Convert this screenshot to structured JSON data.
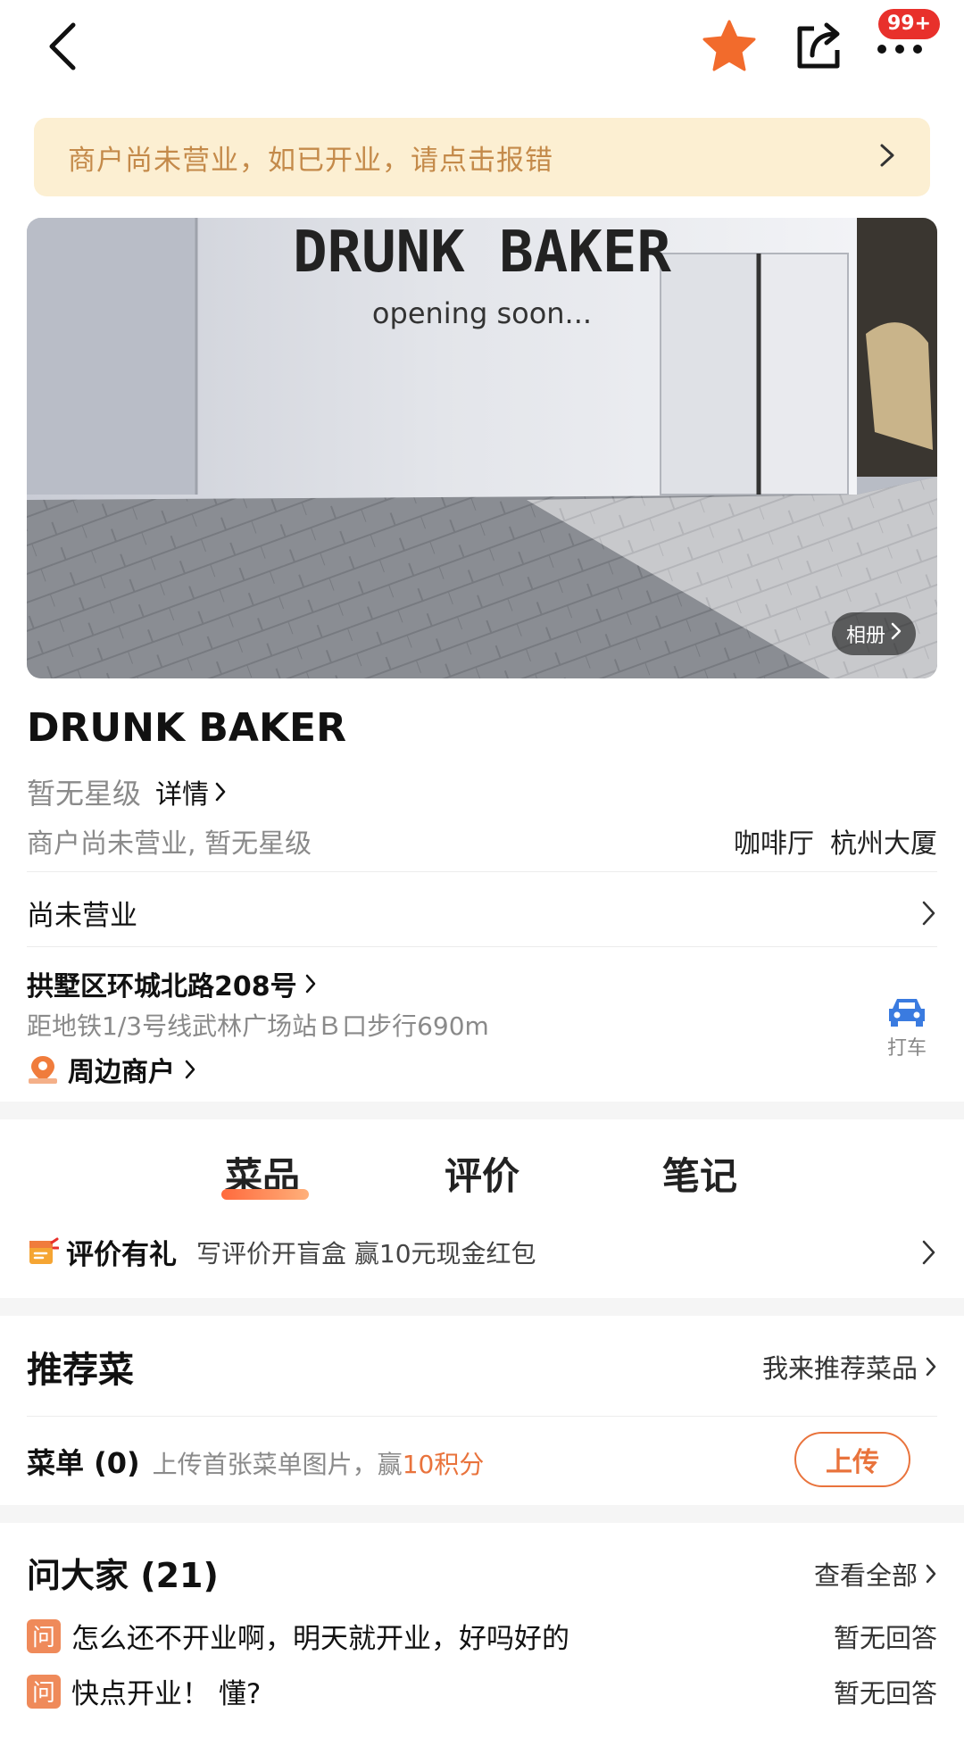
{
  "nav": {
    "badge": "99+"
  },
  "notice": {
    "text": "商户尚未营业，如已开业，请点击报错"
  },
  "photo": {
    "album_label": "相册",
    "sign_title": "DRUNK BAKER",
    "sign_subtitle": "opening soon..."
  },
  "shop": {
    "name": "DRUNK BAKER",
    "rating_text": "暂无星级",
    "details_label": "详情",
    "status_desc": "商户尚未营业, 暂无星级",
    "category": "咖啡厅",
    "area": "杭州大厦",
    "business_status": "尚未营业",
    "address": "拱墅区环城北路208号",
    "metro_distance": "距地铁1/3号线武林广场站Ｂ口步行690m",
    "taxi_label": "打车",
    "nearby_label": "周边商户"
  },
  "tabs": [
    {
      "label": "菜品"
    },
    {
      "label": "评价"
    },
    {
      "label": "笔记"
    }
  ],
  "promo": {
    "title": "评价有礼",
    "desc": "写评价开盲盒 赢10元现金红包"
  },
  "recommend": {
    "title": "推荐菜",
    "action": "我来推荐菜品",
    "menu_label": "菜单 (0)",
    "menu_hint": "上传首张菜单图片，赢",
    "menu_reward": "10积分",
    "upload_button": "上传"
  },
  "ask": {
    "title": "问大家 (21)",
    "view_all": "查看全部",
    "tag": "问",
    "questions": [
      {
        "text": "怎么还不开业啊，明天就开业，好吗好的",
        "status": "暂无回答"
      },
      {
        "text": "快点开业！ 懂?",
        "status": "暂无回答"
      }
    ]
  },
  "colors": {
    "accent": "#e9733c",
    "notice_bg": "#fcefd2",
    "notice_text": "#c48a4a",
    "star": "#f26b2c",
    "taxi": "#3a7be0"
  }
}
